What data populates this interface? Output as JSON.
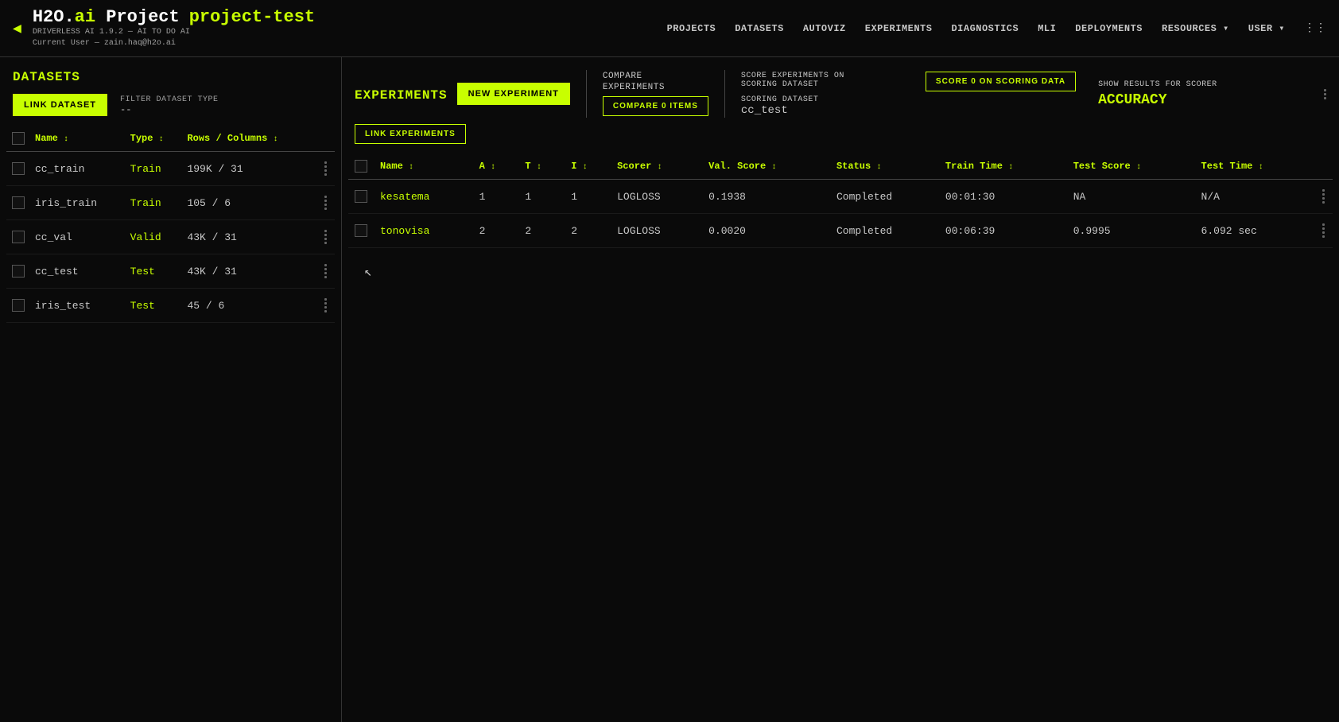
{
  "header": {
    "back_arrow": "◀",
    "logo_h2o": "H2O.ai",
    "logo_project": "Project",
    "project_name": "project-test",
    "subtitle_line1": "DRIVERLESS AI 1.9.2 — AI TO DO AI",
    "subtitle_line2": "Current User — zain.haq@h2o.ai",
    "nav_items": [
      "PROJECTS",
      "DATASETS",
      "AUTOVIZ",
      "EXPERIMENTS",
      "DIAGNOSTICS",
      "MLI",
      "DEPLOYMENTS",
      "RESOURCES ▾",
      "USER ▾"
    ]
  },
  "datasets": {
    "title": "DATASETS",
    "link_button": "LINK DATASET",
    "filter_label": "FILTER DATASET TYPE",
    "filter_value": "--",
    "columns": [
      {
        "label": "Name",
        "sort": "↕"
      },
      {
        "label": "Type",
        "sort": "↕"
      },
      {
        "label": "Rows / Columns",
        "sort": "↕"
      }
    ],
    "rows": [
      {
        "name": "cc_train",
        "type": "Train",
        "rows_cols": "199K / 31"
      },
      {
        "name": "iris_train",
        "type": "Train",
        "rows_cols": "105 / 6"
      },
      {
        "name": "cc_val",
        "type": "Valid",
        "rows_cols": "43K / 31"
      },
      {
        "name": "cc_test",
        "type": "Test",
        "rows_cols": "43K / 31"
      },
      {
        "name": "iris_test",
        "type": "Test",
        "rows_cols": "45 / 6"
      }
    ]
  },
  "experiments": {
    "title": "EXPERIMENTS",
    "new_button": "NEW EXPERIMENT",
    "link_button": "LINK EXPERIMENTS",
    "compare_label_line1": "COMPARE",
    "compare_label_line2": "EXPERIMENTS",
    "compare_items_button": "COMPARE 0 ITEMS",
    "score_label": "SCORE EXPERIMENTS ON",
    "score_label2": "SCORING DATASET",
    "score_dataset_label": "SCORING DATASET",
    "score_dataset_value": "cc_test",
    "score_button": "SCORE 0 ON SCORING DATA",
    "show_results_label": "SHOW RESULTS FOR SCORER",
    "show_results_value": "ACCURACY",
    "columns": [
      {
        "label": "Name",
        "sort": "↕"
      },
      {
        "label": "A",
        "sort": "↕"
      },
      {
        "label": "T",
        "sort": "↕"
      },
      {
        "label": "I",
        "sort": "↕"
      },
      {
        "label": "Scorer",
        "sort": "↕"
      },
      {
        "label": "Val. Score",
        "sort": "↕"
      },
      {
        "label": "Status",
        "sort": "↕"
      },
      {
        "label": "Train Time",
        "sort": "↕"
      },
      {
        "label": "Test Score",
        "sort": "↕"
      },
      {
        "label": "Test Time",
        "sort": "↕"
      }
    ],
    "rows": [
      {
        "name": "kesatema",
        "a": "1",
        "t": "1",
        "i": "1",
        "scorer": "LOGLOSS",
        "val_score": "0.1938",
        "status": "Completed",
        "train_time": "00:01:30",
        "test_score": "NA",
        "test_time": "N/A"
      },
      {
        "name": "tonovisa",
        "a": "2",
        "t": "2",
        "i": "2",
        "scorer": "LOGLOSS",
        "val_score": "0.0020",
        "status": "Completed",
        "train_time": "00:06:39",
        "test_score": "0.9995",
        "test_time": "6.092 sec"
      }
    ]
  }
}
